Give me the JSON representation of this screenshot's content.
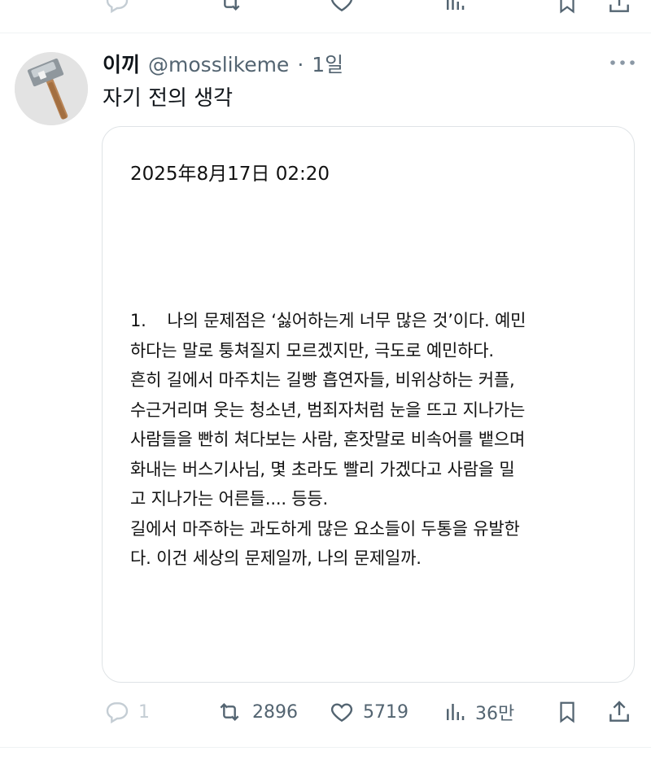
{
  "previous_tweet": {
    "icons": [
      "reply-icon",
      "retweet-icon",
      "like-icon",
      "views-icon",
      "bookmark-icon",
      "share-icon"
    ]
  },
  "tweet": {
    "author": {
      "display_name": "이끼",
      "handle": "@mosslikeme",
      "separator": "·",
      "time": "1일"
    },
    "text": "자기 전의 생각",
    "card": {
      "date": "2025年8月17日 02:20",
      "lines": [
        "1.    나의 문제점은 ‘싫어하는게 너무 많은 것’이다. 예민",
        "하다는 말로 퉁쳐질지 모르겠지만, 극도로 예민하다.",
        "흔히 길에서 마주치는 길빵 흡연자들, 비위상하는 커플,",
        "수근거리며 웃는 청소년, 범죄자처럼 눈을 뜨고 지나가는",
        "사람들을 빤히 쳐다보는 사람, 혼잣말로 비속어를 뱉으며",
        "화내는 버스기사님, 몇 초라도 빨리 가겠다고 사람을 밀",
        "고 지나가는 어른들.... 등등.",
        "길에서 마주하는 과도하게 많은 요소들이 두통을 유발한",
        "다. 이건 세상의 문제일까, 나의 문제일까."
      ]
    },
    "actions": {
      "replies": "1",
      "retweets": "2896",
      "likes": "5719",
      "views": "36만"
    },
    "colors": {
      "secondary": "#536471",
      "reply_faded": "#c4cdd4",
      "divider": "#eff3f4"
    }
  }
}
